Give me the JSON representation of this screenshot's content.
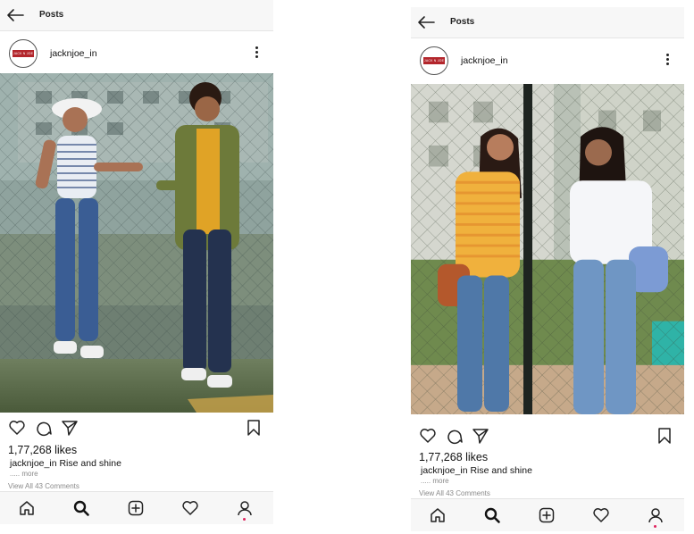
{
  "colors": {
    "bar_bg": "#f7f7f7",
    "brand_red": "#b3262c",
    "notification_dot": "#e0245e",
    "muted_text": "#8a8a8a"
  },
  "posts": [
    {
      "header_title": "Posts",
      "username": "jacknjoe_in",
      "avatar_logo": "JACK N JOE",
      "likes": "1,77,268 likes",
      "caption_user": "jacknjoe_in",
      "caption_text": " Rise and shine",
      "more": "..... more",
      "comments": "View All 43 Comments"
    },
    {
      "header_title": "Posts",
      "username": "jacknjoe_in",
      "avatar_logo": "JACK N JOE",
      "likes": "1,77,268 likes",
      "caption_user": "jacknjoe_in",
      "caption_text": " Rise and shine",
      "more": "..... more",
      "comments": "View All 43 Comments"
    }
  ],
  "icons": {
    "back": "back-arrow-icon",
    "more": "more-vertical-icon",
    "like": "heart-icon",
    "comment": "comment-icon",
    "share": "send-icon",
    "save": "bookmark-icon",
    "home": "home-icon",
    "search": "search-icon",
    "new_post": "add-post-icon",
    "activity": "heart-icon",
    "profile": "profile-icon"
  }
}
